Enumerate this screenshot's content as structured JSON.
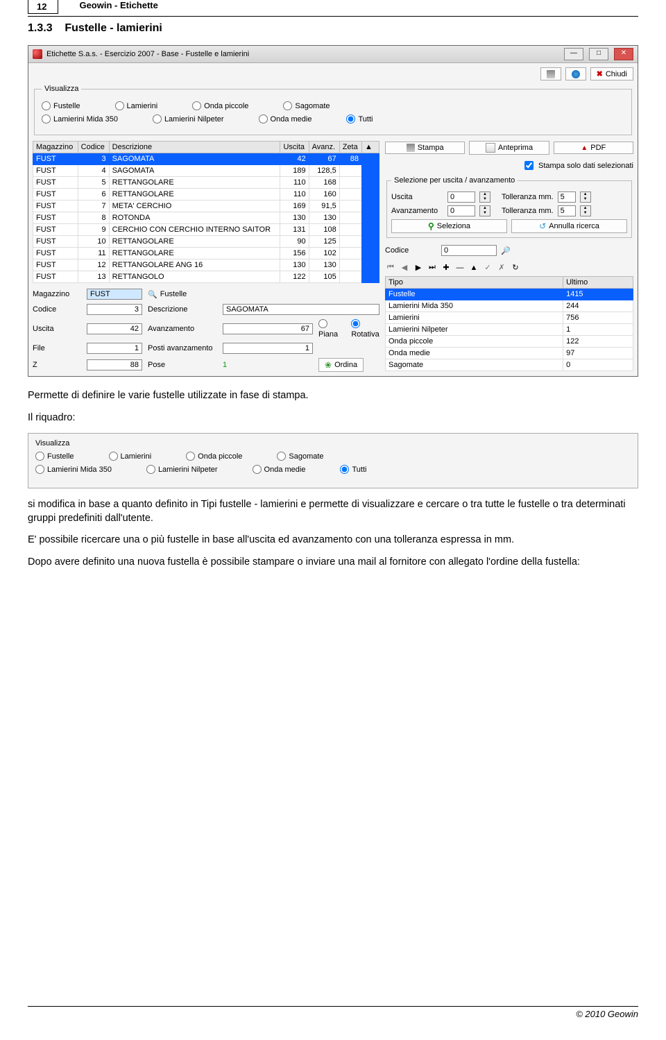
{
  "page": {
    "number": "12",
    "title": "Geowin - Etichette"
  },
  "section": {
    "num": "1.3.3",
    "title": "Fustelle - lamierini"
  },
  "window": {
    "title": "Etichette S.a.s. - Esercizio 2007 - Base - Fustelle e lamierini",
    "close_label": "Chiudi"
  },
  "visualizza": {
    "legend": "Visualizza",
    "opts": {
      "fustelle": "Fustelle",
      "lamierini": "Lamierini",
      "onda_piccole": "Onda piccole",
      "sagomate": "Sagomate",
      "mida350": "Lamierini Mida 350",
      "nilpeter": "Lamierini Nilpeter",
      "onda_medie": "Onda medie",
      "tutti": "Tutti"
    },
    "selected": "tutti"
  },
  "grid": {
    "headers": {
      "magazzino": "Magazzino",
      "codice": "Codice",
      "descrizione": "Descrizione",
      "uscita": "Uscita",
      "avanz": "Avanz.",
      "zeta": "Zeta"
    },
    "rows": [
      {
        "magazzino": "FUST",
        "codice": "3",
        "descrizione": "SAGOMATA",
        "uscita": "42",
        "avanz": "67",
        "zeta": "88",
        "selected": true
      },
      {
        "magazzino": "FUST",
        "codice": "4",
        "descrizione": "SAGOMATA",
        "uscita": "189",
        "avanz": "128,5",
        "zeta": ""
      },
      {
        "magazzino": "FUST",
        "codice": "5",
        "descrizione": "RETTANGOLARE",
        "uscita": "110",
        "avanz": "168",
        "zeta": ""
      },
      {
        "magazzino": "FUST",
        "codice": "6",
        "descrizione": "RETTANGOLARE",
        "uscita": "110",
        "avanz": "160",
        "zeta": ""
      },
      {
        "magazzino": "FUST",
        "codice": "7",
        "descrizione": "META' CERCHIO",
        "uscita": "169",
        "avanz": "91,5",
        "zeta": ""
      },
      {
        "magazzino": "FUST",
        "codice": "8",
        "descrizione": "ROTONDA",
        "uscita": "130",
        "avanz": "130",
        "zeta": ""
      },
      {
        "magazzino": "FUST",
        "codice": "9",
        "descrizione": "CERCHIO CON CERCHIO INTERNO SAITOR",
        "uscita": "131",
        "avanz": "108",
        "zeta": ""
      },
      {
        "magazzino": "FUST",
        "codice": "10",
        "descrizione": "RETTANGOLARE",
        "uscita": "90",
        "avanz": "125",
        "zeta": ""
      },
      {
        "magazzino": "FUST",
        "codice": "11",
        "descrizione": "RETTANGOLARE",
        "uscita": "156",
        "avanz": "102",
        "zeta": ""
      },
      {
        "magazzino": "FUST",
        "codice": "12",
        "descrizione": "RETTANGOLARE ANG 16",
        "uscita": "130",
        "avanz": "130",
        "zeta": ""
      },
      {
        "magazzino": "FUST",
        "codice": "13",
        "descrizione": "RETTANGOLO",
        "uscita": "122",
        "avanz": "105",
        "zeta": ""
      }
    ]
  },
  "right": {
    "stampa": "Stampa",
    "anteprima": "Anteprima",
    "pdf": "PDF",
    "chk_label": "Stampa solo dati selezionati",
    "sel_legend": "Selezione per uscita / avanzamento",
    "uscita": "Uscita",
    "avanzamento": "Avanzamento",
    "tolleranza": "Tolleranza mm.",
    "uscita_val": "0",
    "avanz_val": "0",
    "toll1": "5",
    "toll2": "5",
    "seleziona": "Seleziona",
    "annulla": "Annulla ricerca",
    "codice_label": "Codice",
    "codice_val": "0"
  },
  "types": {
    "headers": {
      "tipo": "Tipo",
      "ultimo": "Ultimo"
    },
    "rows": [
      {
        "tipo": "Fustelle",
        "ultimo": "1415",
        "selected": true
      },
      {
        "tipo": "Lamierini Mida 350",
        "ultimo": "244"
      },
      {
        "tipo": "Lamierini",
        "ultimo": "756"
      },
      {
        "tipo": "Lamierini Nilpeter",
        "ultimo": "1"
      },
      {
        "tipo": "Onda piccole",
        "ultimo": "122"
      },
      {
        "tipo": "Onda medie",
        "ultimo": "97"
      },
      {
        "tipo": "Sagomate",
        "ultimo": "0"
      }
    ]
  },
  "detail": {
    "magazzino_l": "Magazzino",
    "magazzino_v": "FUST",
    "magazzino_type": "Fustelle",
    "codice_l": "Codice",
    "codice_v": "3",
    "descrizione_l": "Descrizione",
    "descrizione_v": "SAGOMATA",
    "uscita_l": "Uscita",
    "uscita_v": "42",
    "avanzamento_l": "Avanzamento",
    "avanzamento_v": "67",
    "piana": "Piana",
    "rotativa": "Rotativa",
    "file_l": "File",
    "file_v": "1",
    "posti_l": "Posti avanzamento",
    "posti_v": "1",
    "z_l": "Z",
    "z_v": "88",
    "pose_l": "Pose",
    "pose_v": "1",
    "ordina": "Ordina"
  },
  "text": {
    "p1": "Permette di definire le varie fustelle utilizzate in fase di stampa.",
    "p2": "Il riquadro:",
    "p3": "si modifica in base a quanto definito in Tipi fustelle - lamierini e permette di visualizzare e cercare o tra tutte le fustelle o tra determinati gruppi predefiniti dall'utente.",
    "p4": "E' possibile ricercare una o più fustelle in base all'uscita ed avanzamento con una tolleranza espressa in mm.",
    "p5": "Dopo avere definito una nuova fustella è possibile stampare o inviare una mail al fornitore con allegato l'ordine della fustella:"
  },
  "footer": "© 2010 Geowin"
}
